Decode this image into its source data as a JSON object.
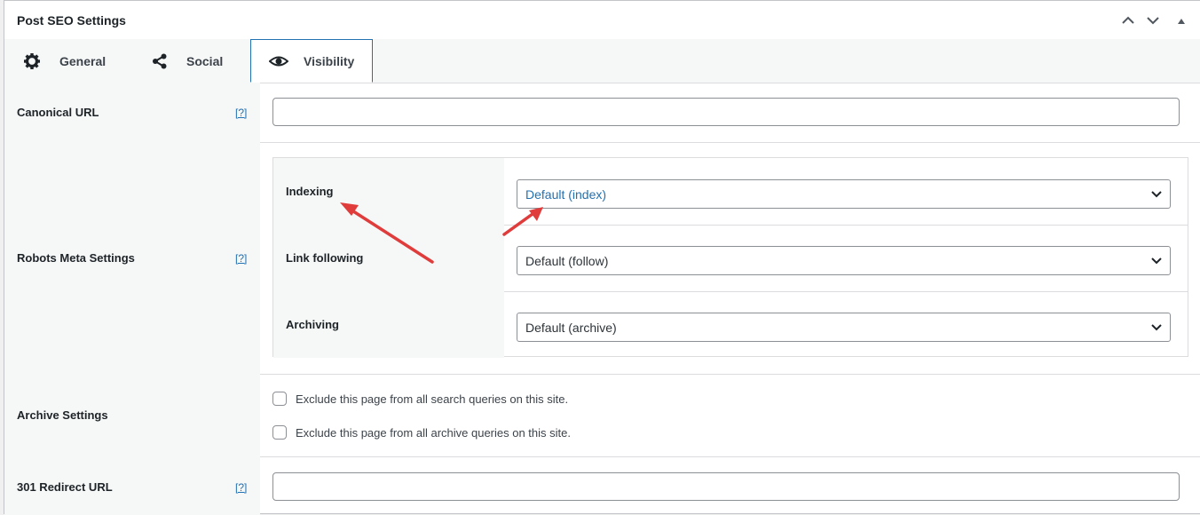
{
  "panel": {
    "title": "Post SEO Settings"
  },
  "tabs": [
    {
      "label": "General",
      "icon": "gear-icon"
    },
    {
      "label": "Social",
      "icon": "share-icon"
    },
    {
      "label": "Visibility",
      "icon": "eye-icon",
      "active": true
    }
  ],
  "canonical": {
    "label": "Canonical URL",
    "help": "[?]",
    "value": ""
  },
  "robots": {
    "label": "Robots Meta Settings",
    "help": "[?]",
    "indexing": {
      "label": "Indexing",
      "value": "Default (index)"
    },
    "following": {
      "label": "Link following",
      "value": "Default (follow)"
    },
    "archiving": {
      "label": "Archiving",
      "value": "Default (archive)"
    }
  },
  "archive": {
    "label": "Archive Settings",
    "search_checkbox": "Exclude this page from all search queries on this site.",
    "archive_checkbox": "Exclude this page from all archive queries on this site."
  },
  "redirect": {
    "label": "301 Redirect URL",
    "help": "[?]",
    "value": ""
  },
  "colors": {
    "accent": "#2271b1",
    "annotation_arrow": "#e03c3c"
  }
}
